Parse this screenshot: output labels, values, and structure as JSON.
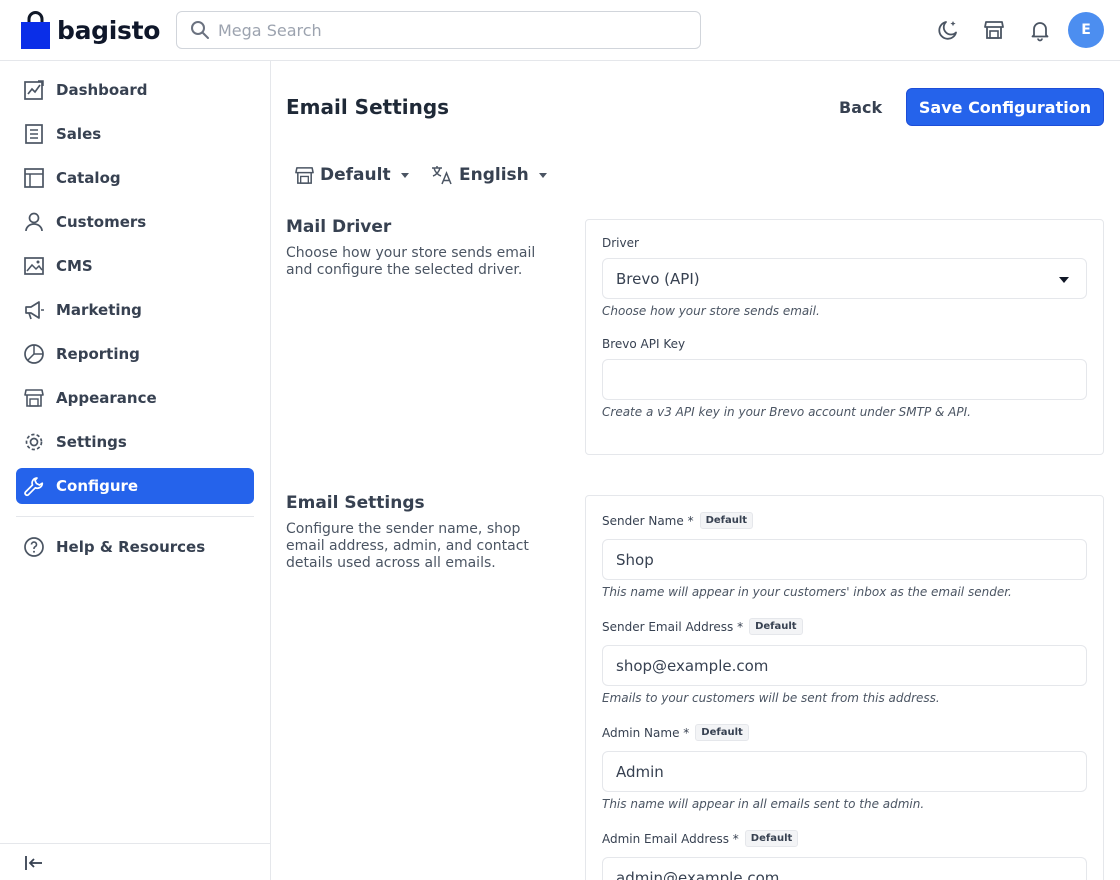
{
  "header": {
    "brand": "bagisto",
    "search_placeholder": "Mega Search",
    "avatar_initial": "E",
    "accent_color": "#2563eb"
  },
  "sidebar": {
    "items": [
      {
        "label": "Dashboard",
        "icon": "dashboard-icon"
      },
      {
        "label": "Sales",
        "icon": "sales-icon"
      },
      {
        "label": "Catalog",
        "icon": "catalog-icon"
      },
      {
        "label": "Customers",
        "icon": "customers-icon"
      },
      {
        "label": "CMS",
        "icon": "cms-icon"
      },
      {
        "label": "Marketing",
        "icon": "marketing-icon"
      },
      {
        "label": "Reporting",
        "icon": "reporting-icon"
      },
      {
        "label": "Appearance",
        "icon": "appearance-icon"
      },
      {
        "label": "Settings",
        "icon": "settings-icon"
      },
      {
        "label": "Configure",
        "icon": "configure-icon",
        "active": true
      }
    ],
    "help_label": "Help & Resources"
  },
  "page": {
    "title": "Email Settings",
    "back_label": "Back",
    "save_label": "Save Configuration",
    "channel": "Default",
    "locale": "English"
  },
  "mail_driver": {
    "title": "Mail Driver",
    "description": "Choose how your store sends email and configure the selected driver.",
    "driver_label": "Driver",
    "driver_value": "Brevo (API)",
    "driver_hint": "Choose how your store sends email.",
    "api_key_label": "Brevo API Key",
    "api_key_value": "",
    "api_key_hint": "Create a v3 API key in your Brevo account under SMTP & API."
  },
  "email_settings": {
    "title": "Email Settings",
    "description": "Configure the sender name, shop email address, admin, and contact details used across all emails.",
    "badge": "Default",
    "fields": [
      {
        "label": "Sender Name *",
        "value": "Shop",
        "hint": "This name will appear in your customers' inbox as the email sender."
      },
      {
        "label": "Sender Email Address *",
        "value": "shop@example.com",
        "hint": "Emails to your customers will be sent from this address."
      },
      {
        "label": "Admin Name *",
        "value": "Admin",
        "hint": "This name will appear in all emails sent to the admin."
      },
      {
        "label": "Admin Email Address *",
        "value": "admin@example.com",
        "hint": ""
      }
    ]
  }
}
